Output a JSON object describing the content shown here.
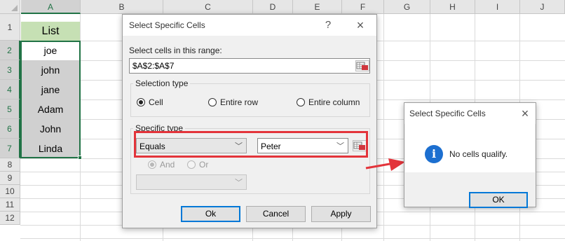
{
  "sheet": {
    "columns": [
      "A",
      "B",
      "C",
      "D",
      "E",
      "F",
      "G",
      "H",
      "I",
      "J"
    ],
    "rows": [
      "1",
      "2",
      "3",
      "4",
      "5",
      "6",
      "7",
      "8",
      "9",
      "10",
      "11",
      "12"
    ],
    "cells": [
      "List",
      "joe",
      "john",
      "jane",
      "Adam",
      "John",
      "Linda"
    ]
  },
  "dialog": {
    "title": "Select Specific Cells",
    "help": "?",
    "close": "×",
    "range_label": "Select cells in this range:",
    "range_value": "$A$2:$A$7",
    "selection_group": "Selection type",
    "sel_cell": "Cell",
    "sel_row": "Entire row",
    "sel_column": "Entire column",
    "specific_group": "Specific type",
    "condition": "Equals",
    "criteria": "Peter",
    "and_label": "And",
    "or_label": "Or",
    "ok": "Ok",
    "cancel": "Cancel",
    "apply": "Apply"
  },
  "message": {
    "title": "Select Specific Cells",
    "close": "×",
    "text": "No cells qualify.",
    "ok": "OK"
  },
  "colors": {
    "header_fill": "#c6e0b4",
    "selected_fill": "#d0d0d0",
    "accent": "#217346",
    "highlight": "#e3343b",
    "info": "#1c6fd0"
  }
}
